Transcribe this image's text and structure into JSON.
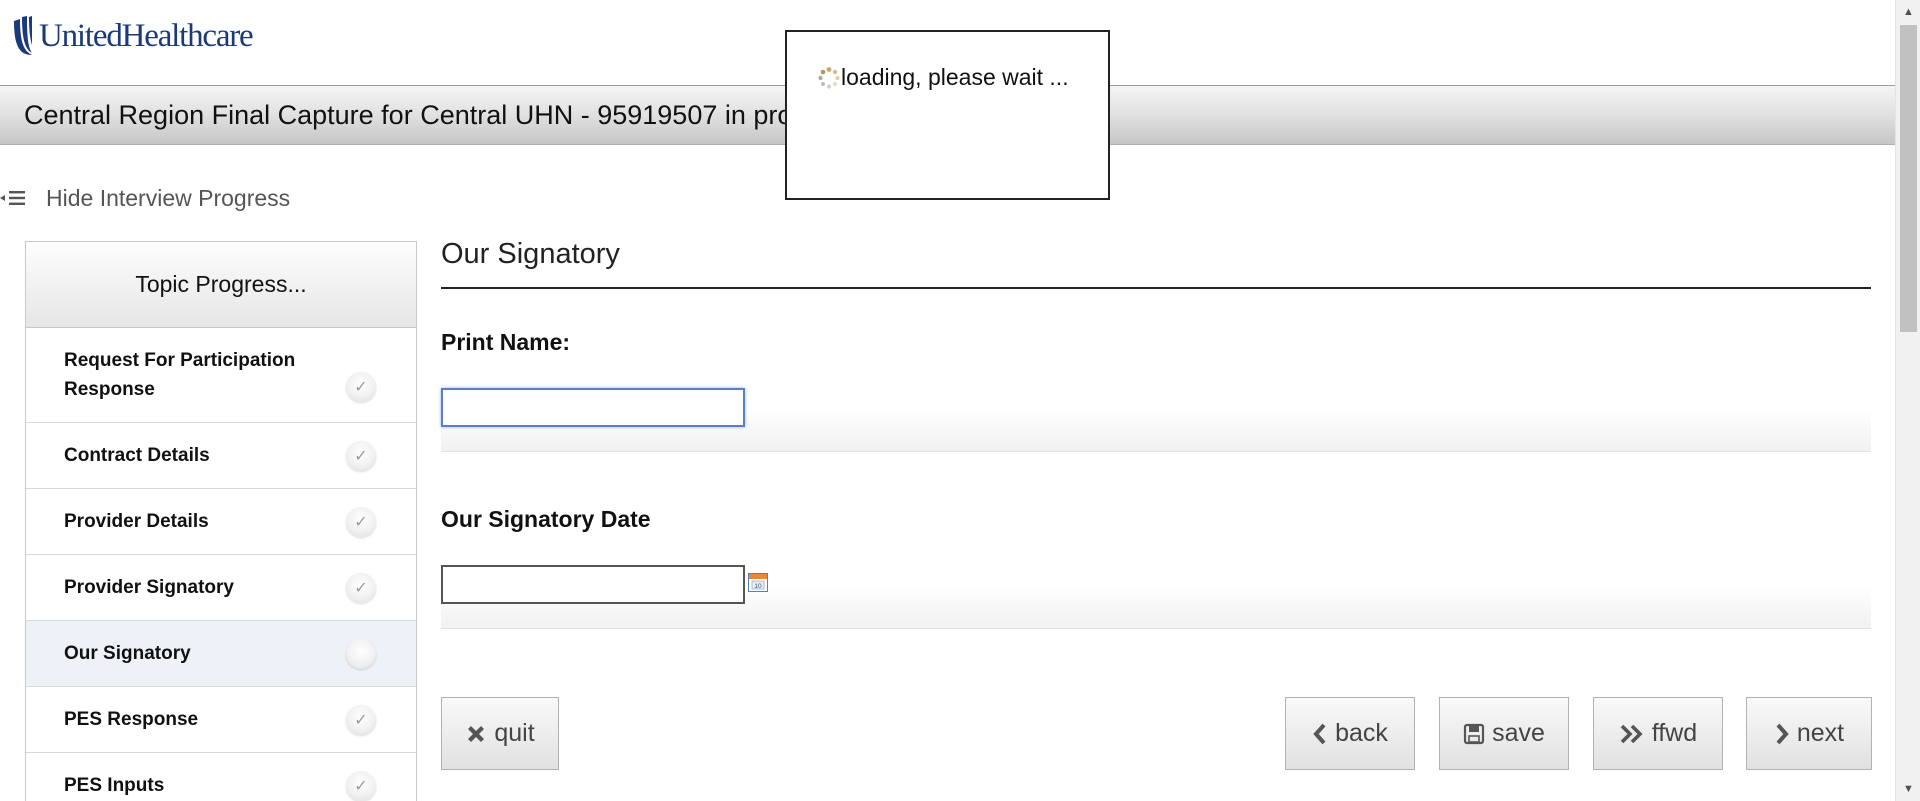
{
  "header": {
    "logo_text": "UnitedHealthcare",
    "title": "Central Region Final Capture for Central UHN - 95919507 in pro"
  },
  "progress_toggle": {
    "label": "Hide Interview Progress",
    "icon": "list-collapse-icon"
  },
  "sidebar": {
    "heading": "Topic Progress...",
    "topics": [
      {
        "label": "Request For Participation Response",
        "status": "complete"
      },
      {
        "label": "Contract Details",
        "status": "complete"
      },
      {
        "label": "Provider Details",
        "status": "complete"
      },
      {
        "label": "Provider Signatory",
        "status": "complete"
      },
      {
        "label": "Our Signatory",
        "status": "current"
      },
      {
        "label": "PES Response",
        "status": "complete"
      },
      {
        "label": "PES Inputs",
        "status": "complete"
      }
    ]
  },
  "main": {
    "section_title": "Our Signatory",
    "fields": {
      "print_name": {
        "label": "Print Name:",
        "value": ""
      },
      "signatory_date": {
        "label": "Our Signatory Date",
        "value": ""
      }
    },
    "calendar_icon": "calendar-icon"
  },
  "buttons": {
    "quit": "quit",
    "back": "back",
    "save": "save",
    "ffwd": "ffwd",
    "next": "next"
  },
  "loading": {
    "text": "loading, please wait ...",
    "icon": "spinner-icon"
  },
  "colors": {
    "brand": "#1a3a7a",
    "focus": "#5b80c6",
    "active_topic": "#eef2f8"
  }
}
